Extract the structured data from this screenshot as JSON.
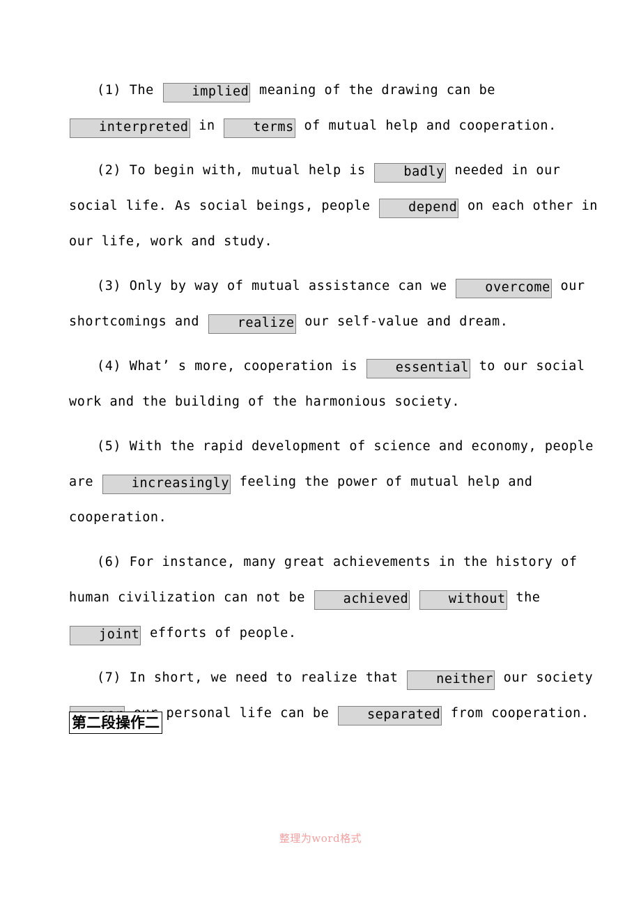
{
  "document": {
    "page_background": "#ffffff",
    "text_color": "#000000",
    "highlight_fill": "#d7d7d7",
    "highlight_border": "#808080",
    "watermark_color": "#f4a0a0",
    "paragraphs": [
      {
        "number": "(1)",
        "segments": [
          {
            "type": "text",
            "value": " The "
          },
          {
            "type": "highlight",
            "value": "implied"
          },
          {
            "type": "text",
            "value": " meaning of the drawing can be "
          },
          {
            "type": "highlight",
            "value": "interpreted"
          },
          {
            "type": "text",
            "value": " in "
          },
          {
            "type": "highlight",
            "value": "terms"
          },
          {
            "type": "text",
            "value": " of mutual help and cooperation."
          }
        ],
        "plain": "(1) The implied meaning of the drawing can be interpreted in terms of mutual help and cooperation."
      },
      {
        "number": "(2)",
        "segments": [
          {
            "type": "text",
            "value": " To begin with, mutual help is "
          },
          {
            "type": "highlight",
            "value": "badly"
          },
          {
            "type": "text",
            "value": " needed in our social life. As social beings, people "
          },
          {
            "type": "highlight",
            "value": "depend"
          },
          {
            "type": "text",
            "value": " on each other in our life, work and study."
          }
        ],
        "plain": "(2) To begin with, mutual help is badly needed in our social life. As social beings, people depend on each other in our life, work and study."
      },
      {
        "number": "(3)",
        "segments": [
          {
            "type": "text",
            "value": " Only by way of mutual assistance can we "
          },
          {
            "type": "highlight",
            "value": "overcome"
          },
          {
            "type": "text",
            "value": " our shortcomings and "
          },
          {
            "type": "highlight",
            "value": "realize"
          },
          {
            "type": "text",
            "value": " our self-value and dream."
          }
        ],
        "plain": "(3) Only by way of mutual assistance can we overcome our shortcomings and realize our self-value and dream."
      },
      {
        "number": "(4)",
        "segments": [
          {
            "type": "text",
            "value": " What’ s more, cooperation is "
          },
          {
            "type": "highlight",
            "value": "essential"
          },
          {
            "type": "text",
            "value": " to our social work and the building of the harmonious society."
          }
        ],
        "plain": "(4) What’ s more, cooperation is essential to our social work and the building of the harmonious society."
      },
      {
        "number": "(5)",
        "segments": [
          {
            "type": "text",
            "value": " With the rapid development of science and economy, people are "
          },
          {
            "type": "highlight",
            "value": "increasingly"
          },
          {
            "type": "text",
            "value": " feeling the power of mutual help and cooperation."
          }
        ],
        "plain": "(5) With the rapid development of science and economy, people are increasingly feeling the power of mutual help and cooperation."
      },
      {
        "number": "(6)",
        "segments": [
          {
            "type": "text",
            "value": " For instance, many great achievements in the history of human civilization can not be "
          },
          {
            "type": "highlight",
            "value": "achieved"
          },
          {
            "type": "text",
            "value": " "
          },
          {
            "type": "highlight",
            "value": "without"
          },
          {
            "type": "text",
            "value": " the "
          },
          {
            "type": "highlight",
            "value": "joint"
          },
          {
            "type": "text",
            "value": " efforts of people."
          }
        ],
        "plain": "(6) For instance, many great achievements in the history of human civilization can not be achieved without the joint efforts of people."
      },
      {
        "number": "(7)",
        "segments": [
          {
            "type": "text",
            "value": " In short, we need to realize that "
          },
          {
            "type": "highlight",
            "value": "neither"
          },
          {
            "type": "text",
            "value": " our society "
          },
          {
            "type": "highlight",
            "value": "nor"
          },
          {
            "type": "text",
            "value": " our personal life can be "
          },
          {
            "type": "highlight",
            "value": "separated"
          },
          {
            "type": "text",
            "value": " from cooperation."
          }
        ],
        "plain": "(7) In short, we need to realize that neither our society nor our personal life can be separated from cooperation."
      }
    ],
    "section_heading": "第二段操作二",
    "watermark": "整理为word格式"
  }
}
